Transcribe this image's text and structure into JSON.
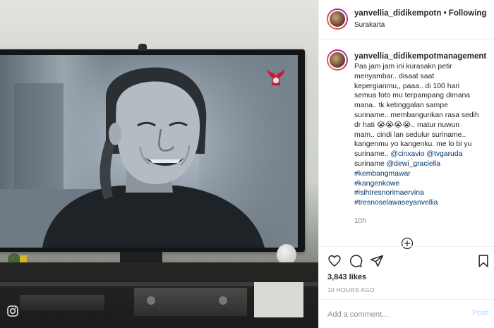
{
  "post": {
    "username": "yanvellia_didikempotn",
    "separator": "•",
    "follow_status": "Following",
    "location": "Surakarta"
  },
  "caption": {
    "username": "yanvellia_didikempotmanagement",
    "lines": [
      "Pas jam jam ini kurasakn petir",
      "menyambar.. disaat saat",
      "kepergianmu,, paaa.. di 100 hari",
      "semua foto mu terpampang dimana",
      "mana.. tk ketinggalan sampe",
      "suriname.. membangunkan rasa sedih",
      "dr hati 😭😭😭😭.. matur nuwun",
      "mam.. cindi lan sedulur suriname..",
      "kangenmu yo kangenku. me lo bi yu"
    ],
    "line10_prefix": "suriname.. ",
    "mention1": "@cinxavio",
    "mention2": "@tvgaruda",
    "line11_prefix": "suriname ",
    "mention3": "@dewi_graciella",
    "hashtags": [
      "#kembangmawar",
      "#kangenkowe",
      "#isihtresnorimaervina",
      "#tresnoselawaseyanvellia"
    ],
    "time": "10h"
  },
  "stats": {
    "likes": "3,843 likes",
    "time_ago": "10 HOURS AGO"
  },
  "comment": {
    "placeholder": "Add a comment...",
    "post_label": "Post"
  },
  "icons": {
    "like": "heart-icon",
    "comment": "comment-icon",
    "share": "share-icon",
    "save": "bookmark-icon",
    "more": "more-options-icon"
  },
  "colors": {
    "link": "#00376b",
    "muted": "#8e8e8e",
    "post_button_disabled": "#b3dbff"
  }
}
